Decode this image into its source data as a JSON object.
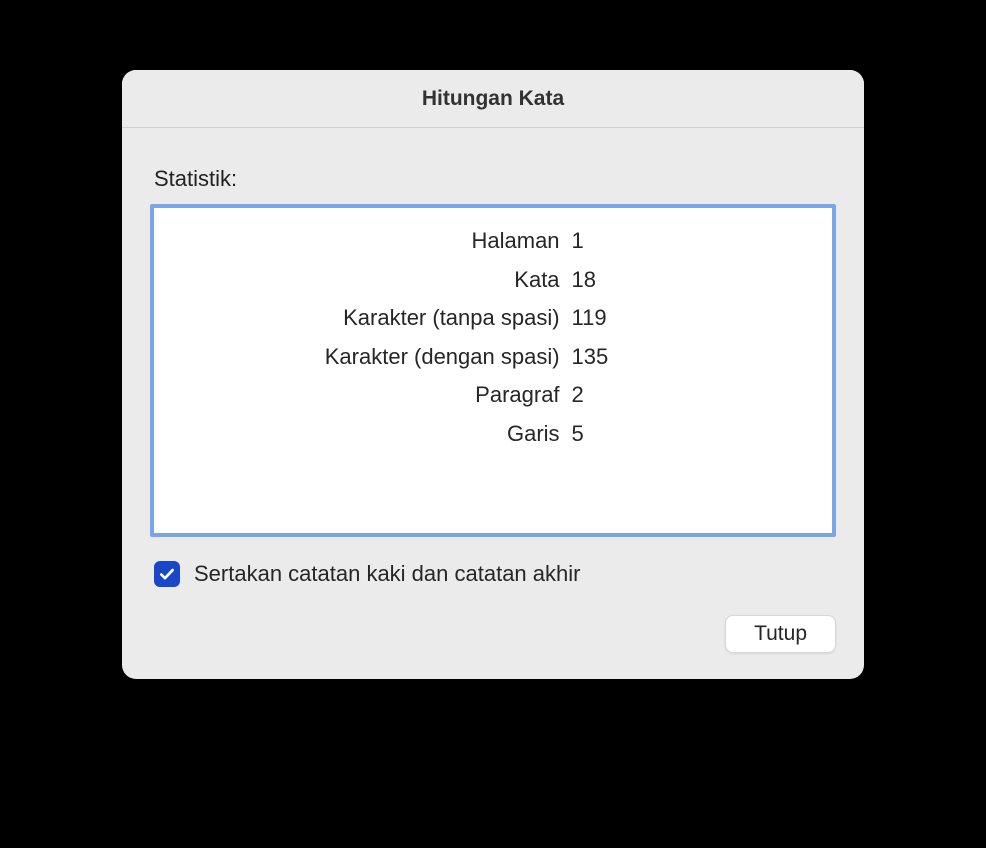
{
  "dialog": {
    "title": "Hitungan Kata",
    "section_label": "Statistik:",
    "stats": [
      {
        "label": "Halaman",
        "value": "1"
      },
      {
        "label": "Kata",
        "value": "18"
      },
      {
        "label": "Karakter (tanpa spasi)",
        "value": "119"
      },
      {
        "label": "Karakter (dengan spasi)",
        "value": "135"
      },
      {
        "label": "Paragraf",
        "value": "2"
      },
      {
        "label": "Garis",
        "value": "5"
      }
    ],
    "checkbox": {
      "label": "Sertakan catatan kaki dan catatan akhir",
      "checked": true
    },
    "close_button": "Tutup"
  }
}
